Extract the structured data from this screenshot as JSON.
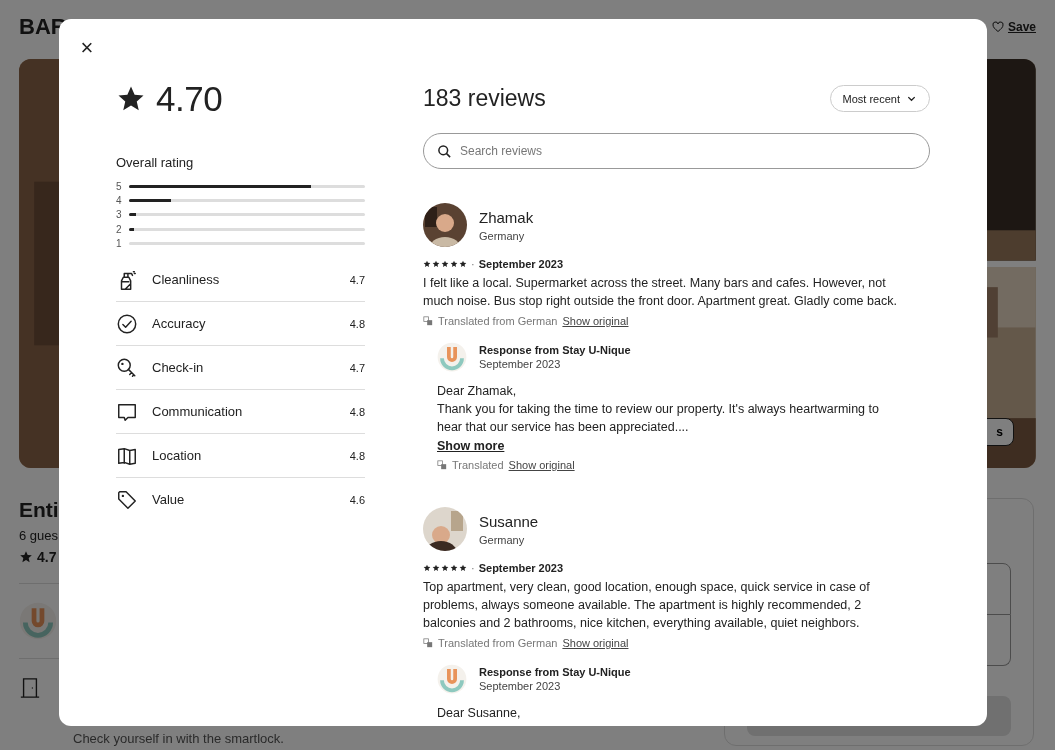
{
  "background_page": {
    "title": "BAR",
    "save": "Save",
    "photo_button": "s",
    "listing_heading": "Enti",
    "guests": "6 gues",
    "rating": "4.7",
    "checkin_note": "Check yourself in with the smartlock."
  },
  "modal": {
    "close": "×",
    "rating": "4.70",
    "overall_label": "Overall rating",
    "distribution": [
      {
        "label": "5",
        "level": 0.77
      },
      {
        "label": "4",
        "level": 0.18
      },
      {
        "label": "3",
        "level": 0.03
      },
      {
        "label": "2",
        "level": 0.02
      },
      {
        "label": "1",
        "level": 0
      }
    ],
    "categories": [
      {
        "kind": "spray",
        "label": "Cleanliness",
        "score": "4.7"
      },
      {
        "kind": "check",
        "label": "Accuracy",
        "score": "4.8"
      },
      {
        "kind": "key",
        "label": "Check-in",
        "score": "4.7"
      },
      {
        "kind": "chat",
        "label": "Communication",
        "score": "4.8"
      },
      {
        "kind": "map",
        "label": "Location",
        "score": "4.8"
      },
      {
        "kind": "tag",
        "label": "Value",
        "score": "4.6"
      }
    ],
    "review_count": "183 reviews",
    "sort": "Most recent",
    "search": {
      "placeholder": "Search reviews"
    },
    "reviews": [
      {
        "name": "Zhamak",
        "country": "Germany",
        "stars": 5,
        "separator": "·",
        "date": "September 2023",
        "text": "I felt like a local. Supermarket across the street. Many bars and cafes. However, not much noise. Bus stop right outside the front door. Apartment great. Gladly come back.",
        "translation": "Translated from German",
        "show_original": "Show original",
        "response": {
          "from": "Response from Stay U-Nique",
          "date": "September 2023",
          "greeting": "Dear Zhamak,",
          "text": "Thank you for taking the time to review our property. It's always heartwarming to hear that our service has been appreciated....",
          "show_more": "Show more",
          "translation": "Translated",
          "show_original": "Show original"
        }
      },
      {
        "name": "Susanne",
        "country": "Germany",
        "stars": 5,
        "separator": "·",
        "date": "September 2023",
        "text": "Top apartment, very clean, good location, enough space, quick service in case of problems, always someone available. The apartment is highly recommended, 2 balconies and 2 bathrooms, nice kitchen, everything available, quiet neighbors.",
        "translation": "Translated from German",
        "show_original": "Show original",
        "response": {
          "from": "Response from Stay U-Nique",
          "date": "September 2023",
          "greeting": "Dear Susanne,"
        }
      }
    ]
  }
}
